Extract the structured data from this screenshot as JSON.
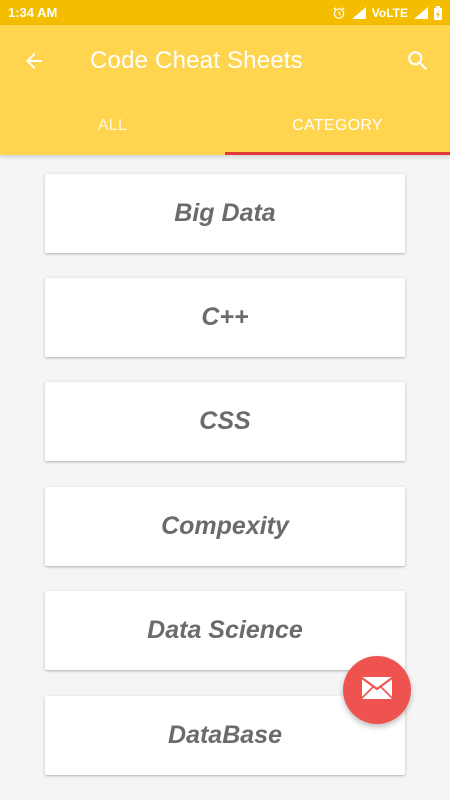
{
  "status_bar": {
    "time": "1:34 AM",
    "network": "VoLTE"
  },
  "toolbar": {
    "title": "Code Cheat Sheets",
    "back_icon": "arrow-back-icon",
    "search_icon": "search-icon"
  },
  "tabs": [
    {
      "label": "ALL",
      "selected": false
    },
    {
      "label": "CATEGORY",
      "selected": true
    }
  ],
  "categories": [
    {
      "label": "Big Data"
    },
    {
      "label": "C++"
    },
    {
      "label": "CSS"
    },
    {
      "label": "Compexity"
    },
    {
      "label": "Data Science"
    },
    {
      "label": "DataBase"
    }
  ],
  "fab": {
    "icon": "mail-icon"
  },
  "colors": {
    "status_bar": "#f4bd00",
    "app_bar": "#ffd54f",
    "tab_indicator": "#e53935",
    "fab": "#ef5350",
    "card_text": "#6b6b6b"
  }
}
